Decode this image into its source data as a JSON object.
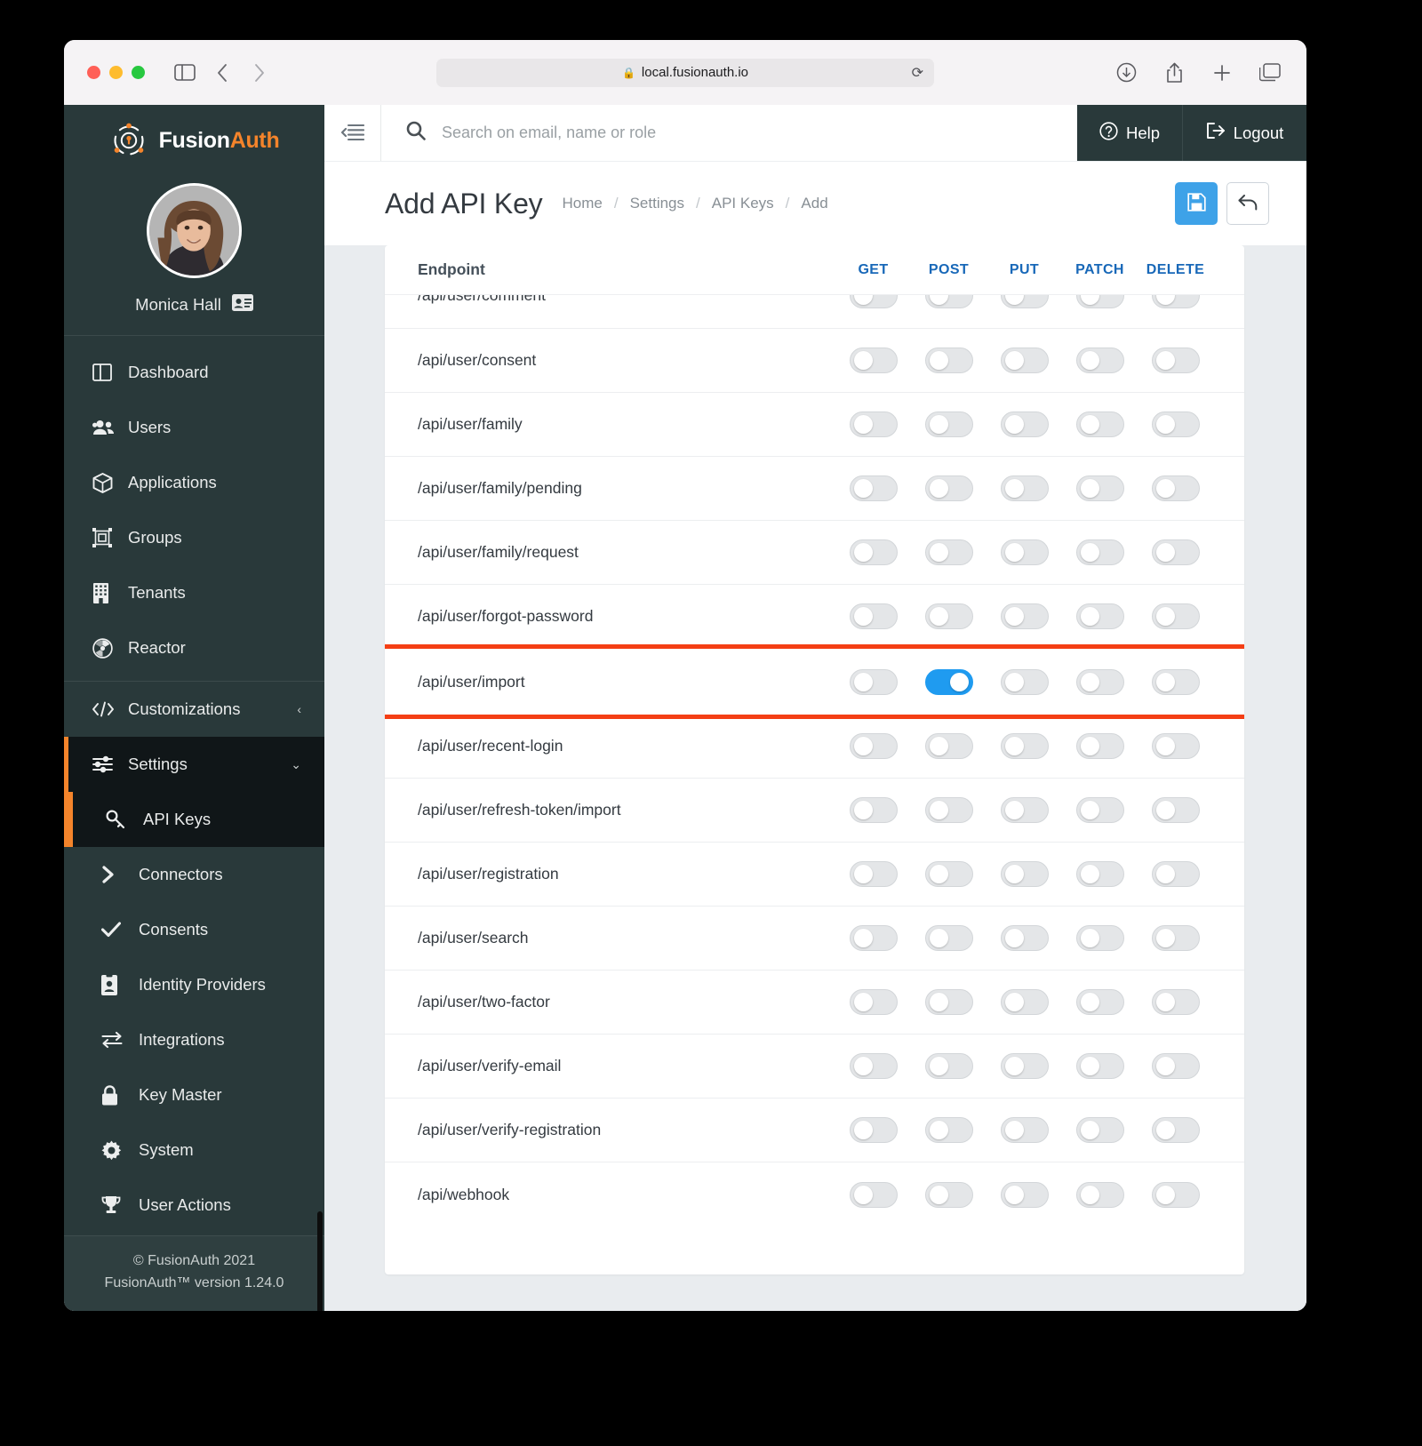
{
  "browser": {
    "url": "local.fusionauth.io",
    "lock_icon": "lock-icon",
    "reload_icon": "reload-icon",
    "sidebar_toggle_icon": "sidebar-toggle-icon",
    "back_icon": "back-arrow-icon",
    "forward_icon": "forward-arrow-icon",
    "shield_icon": "shield-icon",
    "download_icon": "download-icon",
    "share_icon": "share-icon",
    "new_tab_icon": "plus-icon",
    "tabs_icon": "tab-overview-icon"
  },
  "sidebar": {
    "brand_first": "Fusion",
    "brand_second": "Auth",
    "user_name": "Monica Hall",
    "primary_items": [
      {
        "label": "Dashboard",
        "icon": "dashboard-icon"
      },
      {
        "label": "Users",
        "icon": "users-icon"
      },
      {
        "label": "Applications",
        "icon": "box-icon"
      },
      {
        "label": "Groups",
        "icon": "groups-icon"
      },
      {
        "label": "Tenants",
        "icon": "building-icon"
      },
      {
        "label": "Reactor",
        "icon": "reactor-icon"
      }
    ],
    "customizations": {
      "label": "Customizations",
      "icon": "code-icon",
      "chevron": "‹"
    },
    "settings": {
      "label": "Settings",
      "icon": "sliders-icon",
      "chevron": "⌄"
    },
    "settings_items": [
      {
        "label": "API Keys",
        "icon": "key-icon",
        "active": true
      },
      {
        "label": "Connectors",
        "icon": "chevron-right-icon",
        "active": false
      },
      {
        "label": "Consents",
        "icon": "check-icon",
        "active": false
      },
      {
        "label": "Identity Providers",
        "icon": "id-badge-icon",
        "active": false
      },
      {
        "label": "Integrations",
        "icon": "exchange-icon",
        "active": false
      },
      {
        "label": "Key Master",
        "icon": "lock-icon",
        "active": false
      },
      {
        "label": "System",
        "icon": "gear-icon",
        "active": false
      },
      {
        "label": "User Actions",
        "icon": "trophy-icon",
        "active": false
      }
    ],
    "footer_line1": "© FusionAuth 2021",
    "footer_line2": "FusionAuth™ version 1.24.0"
  },
  "topbar": {
    "collapse_icon": "collapse-sidebar-icon",
    "search_placeholder": "Search on email, name or role",
    "search_value": "",
    "search_icon": "search-icon",
    "help_label": "Help",
    "help_icon": "question-circle-icon",
    "logout_label": "Logout",
    "logout_icon": "sign-out-icon"
  },
  "page": {
    "title": "Add API Key",
    "breadcrumbs": [
      "Home",
      "Settings",
      "API Keys",
      "Add"
    ],
    "separator": "/",
    "save_icon": "save-floppy-icon",
    "back_icon": "undo-arrow-icon"
  },
  "table": {
    "header_endpoint": "Endpoint",
    "methods": [
      "GET",
      "POST",
      "PUT",
      "PATCH",
      "DELETE"
    ],
    "highlight_color": "#f43e14",
    "toggle_on_color": "#1f9bf0",
    "rows": [
      {
        "endpoint": "/api/user/comment",
        "clipped": true,
        "highlighted": false,
        "toggles": [
          false,
          false,
          false,
          false,
          false
        ]
      },
      {
        "endpoint": "/api/user/consent",
        "clipped": false,
        "highlighted": false,
        "toggles": [
          false,
          false,
          false,
          false,
          false
        ]
      },
      {
        "endpoint": "/api/user/family",
        "clipped": false,
        "highlighted": false,
        "toggles": [
          false,
          false,
          false,
          false,
          false
        ]
      },
      {
        "endpoint": "/api/user/family/pending",
        "clipped": false,
        "highlighted": false,
        "toggles": [
          false,
          false,
          false,
          false,
          false
        ]
      },
      {
        "endpoint": "/api/user/family/request",
        "clipped": false,
        "highlighted": false,
        "toggles": [
          false,
          false,
          false,
          false,
          false
        ]
      },
      {
        "endpoint": "/api/user/forgot-password",
        "clipped": false,
        "highlighted": false,
        "toggles": [
          false,
          false,
          false,
          false,
          false
        ]
      },
      {
        "endpoint": "/api/user/import",
        "clipped": false,
        "highlighted": true,
        "toggles": [
          false,
          true,
          false,
          false,
          false
        ]
      },
      {
        "endpoint": "/api/user/recent-login",
        "clipped": false,
        "highlighted": false,
        "toggles": [
          false,
          false,
          false,
          false,
          false
        ]
      },
      {
        "endpoint": "/api/user/refresh-token/import",
        "clipped": false,
        "highlighted": false,
        "toggles": [
          false,
          false,
          false,
          false,
          false
        ]
      },
      {
        "endpoint": "/api/user/registration",
        "clipped": false,
        "highlighted": false,
        "toggles": [
          false,
          false,
          false,
          false,
          false
        ]
      },
      {
        "endpoint": "/api/user/search",
        "clipped": false,
        "highlighted": false,
        "toggles": [
          false,
          false,
          false,
          false,
          false
        ]
      },
      {
        "endpoint": "/api/user/two-factor",
        "clipped": false,
        "highlighted": false,
        "toggles": [
          false,
          false,
          false,
          false,
          false
        ]
      },
      {
        "endpoint": "/api/user/verify-email",
        "clipped": false,
        "highlighted": false,
        "toggles": [
          false,
          false,
          false,
          false,
          false
        ]
      },
      {
        "endpoint": "/api/user/verify-registration",
        "clipped": false,
        "highlighted": false,
        "toggles": [
          false,
          false,
          false,
          false,
          false
        ]
      },
      {
        "endpoint": "/api/webhook",
        "clipped": false,
        "highlighted": false,
        "toggles": [
          false,
          false,
          false,
          false,
          false
        ]
      }
    ]
  }
}
